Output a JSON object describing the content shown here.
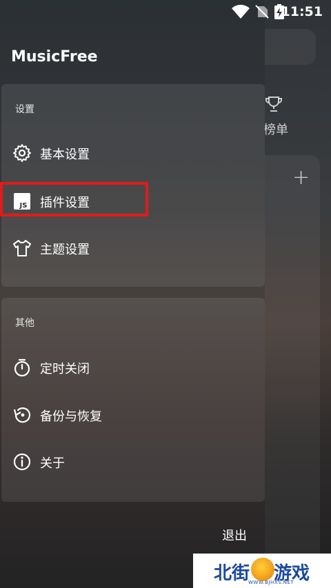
{
  "status_bar": {
    "time": "11:51"
  },
  "background": {
    "rank_label": "榜单"
  },
  "drawer": {
    "app_title": "MusicFree",
    "settings": {
      "header": "设置",
      "items": [
        {
          "label": "基本设置",
          "icon": "gear-icon"
        },
        {
          "label": "插件设置",
          "icon": "js-icon"
        },
        {
          "label": "主题设置",
          "icon": "tshirt-icon"
        }
      ]
    },
    "other": {
      "header": "其他",
      "items": [
        {
          "label": "定时关闭",
          "icon": "timer-icon"
        },
        {
          "label": "备份与恢复",
          "icon": "restore-icon"
        },
        {
          "label": "关于",
          "icon": "info-icon"
        }
      ]
    },
    "exit_label": "退出"
  },
  "highlight_color": "#e11b1b",
  "watermark": {
    "left": "北街",
    "right": "游戏",
    "url": "WWW.BJHXS.NET"
  }
}
